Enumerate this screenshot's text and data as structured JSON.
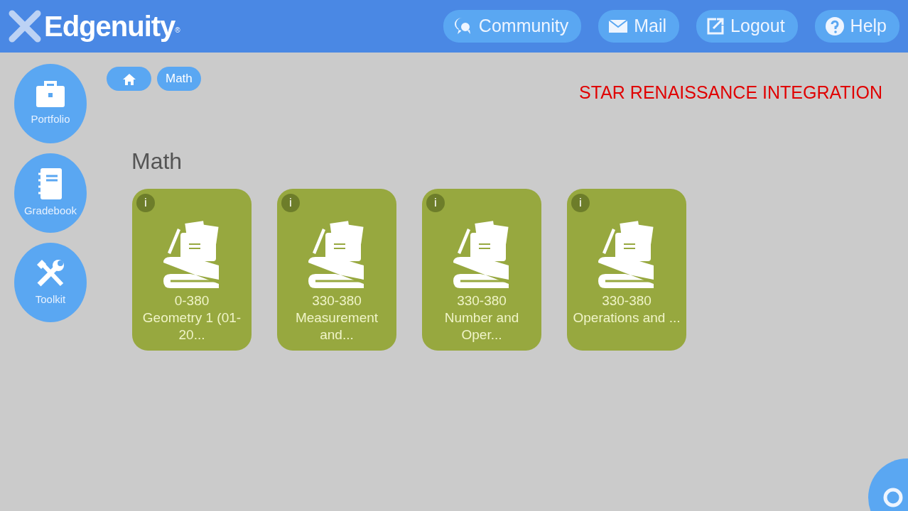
{
  "header": {
    "logo": "Edgenuity",
    "logo_mark": "®",
    "nav": [
      {
        "label": "Community",
        "kind": "community"
      },
      {
        "label": "Mail",
        "kind": "mail"
      },
      {
        "label": "Logout",
        "kind": "logout"
      },
      {
        "label": "Help",
        "kind": "help"
      }
    ]
  },
  "sidebar": {
    "items": [
      {
        "label": "Portfolio",
        "kind": "portfolio"
      },
      {
        "label": "Gradebook",
        "kind": "gradebook"
      },
      {
        "label": "Toolkit",
        "kind": "toolkit"
      }
    ]
  },
  "breadcrumb": [
    {
      "kind": "home"
    },
    {
      "kind": "text",
      "label": "Math"
    }
  ],
  "banner": "STAR RENAISSANCE INTEGRATION",
  "heading": "Math",
  "courses": [
    {
      "info": "i",
      "code": "0-380",
      "name": "Geometry 1 (01-20..."
    },
    {
      "info": "i",
      "code": "330-380",
      "name": "Measurement and..."
    },
    {
      "info": "i",
      "code": "330-380",
      "name": "Number and Oper..."
    },
    {
      "info": "i",
      "code": "330-380",
      "name": "Operations and ..."
    }
  ]
}
